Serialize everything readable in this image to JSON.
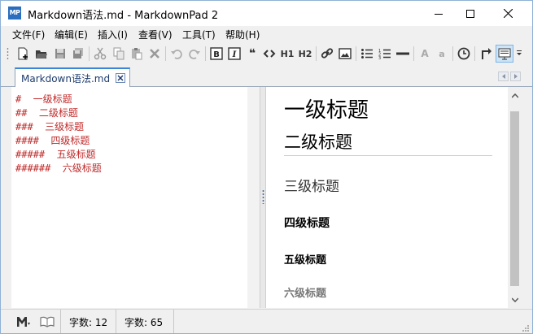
{
  "window": {
    "title": "Markdown语法.md - MarkdownPad 2",
    "app_icon_text": "MP"
  },
  "menu": [
    "文件(F)",
    "编辑(E)",
    "插入(I)",
    "查看(V)",
    "工具(T)",
    "帮助(H)"
  ],
  "toolbar": {
    "h1_label": "H1",
    "h2_label": "H2",
    "quote_label": "❝",
    "font_large": "A",
    "font_small": "a"
  },
  "tab": {
    "label": "Markdown语法.md"
  },
  "editor": {
    "lines": [
      "#  一级标题",
      "##  二级标题",
      "###  三级标题",
      "####  四级标题",
      "#####  五级标题",
      "######  六级标题"
    ]
  },
  "preview": {
    "h1": "一级标题",
    "h2": "二级标题",
    "h3": "三级标题",
    "h4": "四级标题",
    "h5": "五级标题",
    "h6": "六级标题"
  },
  "status": {
    "words": "字数: 12",
    "chars": "字数:  65"
  },
  "colors": {
    "editor_text": "#c22a2a",
    "tab_accent": "#3a86d6",
    "app_icon": "#2a6fbf"
  }
}
